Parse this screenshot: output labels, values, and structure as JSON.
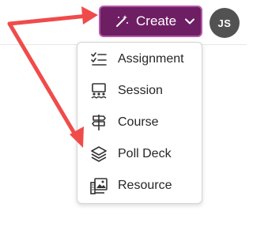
{
  "header": {
    "create_label": "Create",
    "avatar_initials": "JS"
  },
  "menu": {
    "items": [
      {
        "label": "Assignment",
        "icon": "checklist-icon"
      },
      {
        "label": "Session",
        "icon": "session-icon"
      },
      {
        "label": "Course",
        "icon": "signpost-icon"
      },
      {
        "label": "Poll Deck",
        "icon": "layers-icon"
      },
      {
        "label": "Resource",
        "icon": "resource-icon"
      }
    ]
  },
  "colors": {
    "create_button": "#6e1e63",
    "create_button_border": "#b45aa7",
    "avatar": "#525252",
    "annotation_arrow": "#f04b4b"
  }
}
